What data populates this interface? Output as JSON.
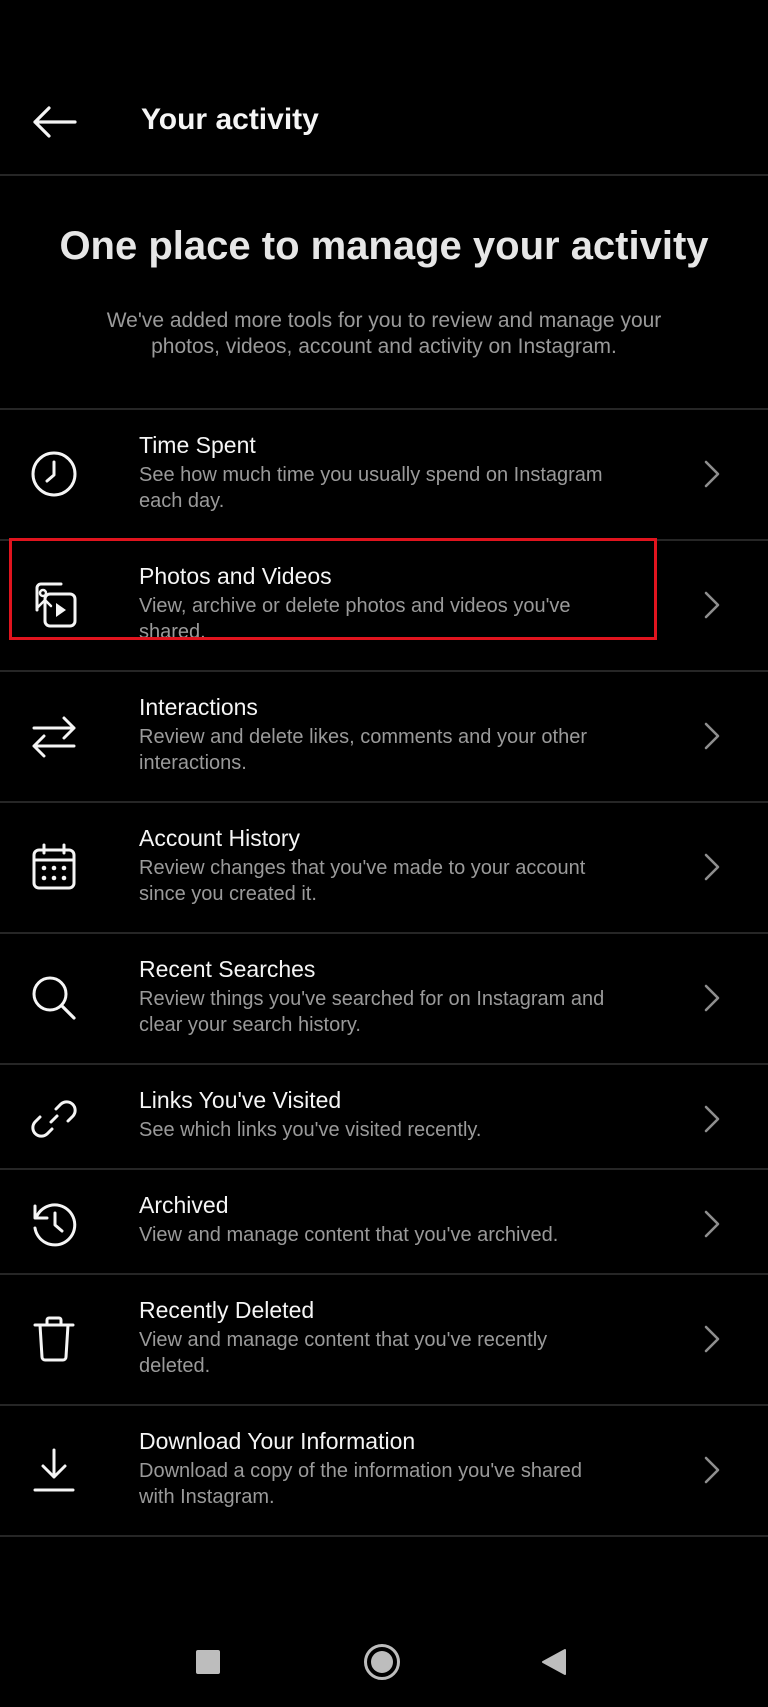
{
  "header": {
    "back_icon": "arrow-left-icon",
    "title": "Your activity"
  },
  "hero": {
    "title": "One place to manage your activity",
    "subtitle": "We've added more tools for you to review and manage your photos, videos, account and activity on Instagram."
  },
  "items": [
    {
      "icon": "clock-icon",
      "title": "Time Spent",
      "desc": "See how much time you usually spend on Instagram each day."
    },
    {
      "icon": "photos-videos-icon",
      "title": "Photos and Videos",
      "desc": "View, archive or delete photos and videos you've shared."
    },
    {
      "icon": "arrows-swap-icon",
      "title": "Interactions",
      "desc": "Review and delete likes, comments and your other interactions."
    },
    {
      "icon": "calendar-icon",
      "title": "Account History",
      "desc": "Review changes that you've made to your account since you created it."
    },
    {
      "icon": "search-icon",
      "title": "Recent Searches",
      "desc": "Review things you've searched for on Instagram and clear your search history."
    },
    {
      "icon": "link-icon",
      "title": "Links You've Visited",
      "desc": "See which links you've visited recently."
    },
    {
      "icon": "archive-history-icon",
      "title": "Archived",
      "desc": "View and manage content that you've archived."
    },
    {
      "icon": "trash-icon",
      "title": "Recently Deleted",
      "desc": "View and manage content that you've recently deleted."
    },
    {
      "icon": "download-icon",
      "title": "Download Your Information",
      "desc": "Download a copy of the information you've shared with Instagram."
    }
  ],
  "highlight_color": "#e0141e",
  "nav": {
    "recents_icon": "square-icon",
    "home_icon": "circle-icon",
    "back_icon": "triangle-back-icon"
  }
}
